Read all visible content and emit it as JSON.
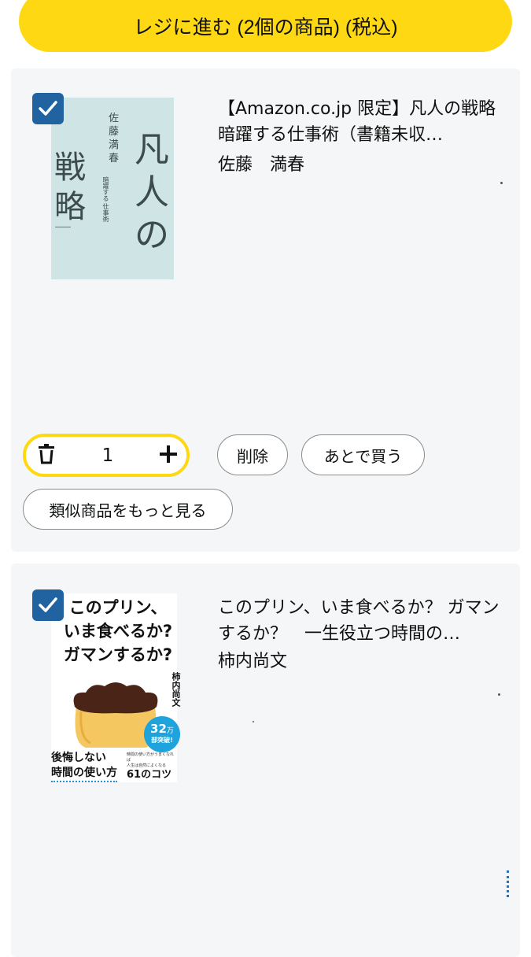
{
  "checkout": {
    "label": "レジに進む (2個の商品) (税込)"
  },
  "items": [
    {
      "title": "【Amazon.co.jp 限定】凡人の戦略　暗躍する仕事術（書籍未収…",
      "author": "佐藤　満春",
      "quantity": "1",
      "cover": {
        "title_chars": [
          "凡",
          "人",
          "の"
        ],
        "sub_chars": [
          "戦",
          "略"
        ],
        "author_chars": [
          "佐",
          "藤",
          "満",
          "春"
        ],
        "tagline_col1": "暗躍する",
        "tagline_col2": "仕事術"
      },
      "actions": {
        "delete": "削除",
        "save_later": "あとで買う",
        "similar": "類似商品をもっと見る"
      }
    },
    {
      "title": "このプリン、いま食べるか？ ガマンするか？　一生役立つ時間の…",
      "author": "柿内尚文",
      "cover": {
        "line1": "このプリン、",
        "line2": "いま食べるか?",
        "line3": "ガマンするか?",
        "author": "柿内尚文",
        "badge_num": "32",
        "badge_unit": "万",
        "badge_text": "部突破!",
        "bottom_left1": "後悔しない",
        "bottom_left2": "時間の使い方",
        "bottom_right": "61のコツ",
        "small1": "時間の使い方がうまくなれば",
        "small2": "人生は自然によくなる"
      }
    }
  ],
  "colors": {
    "accent": "#ffd814",
    "checkbox": "#2162a1",
    "card": "#f5f6f7"
  },
  "icons": [
    "trash-icon",
    "plus-icon",
    "checkmark-icon"
  ]
}
